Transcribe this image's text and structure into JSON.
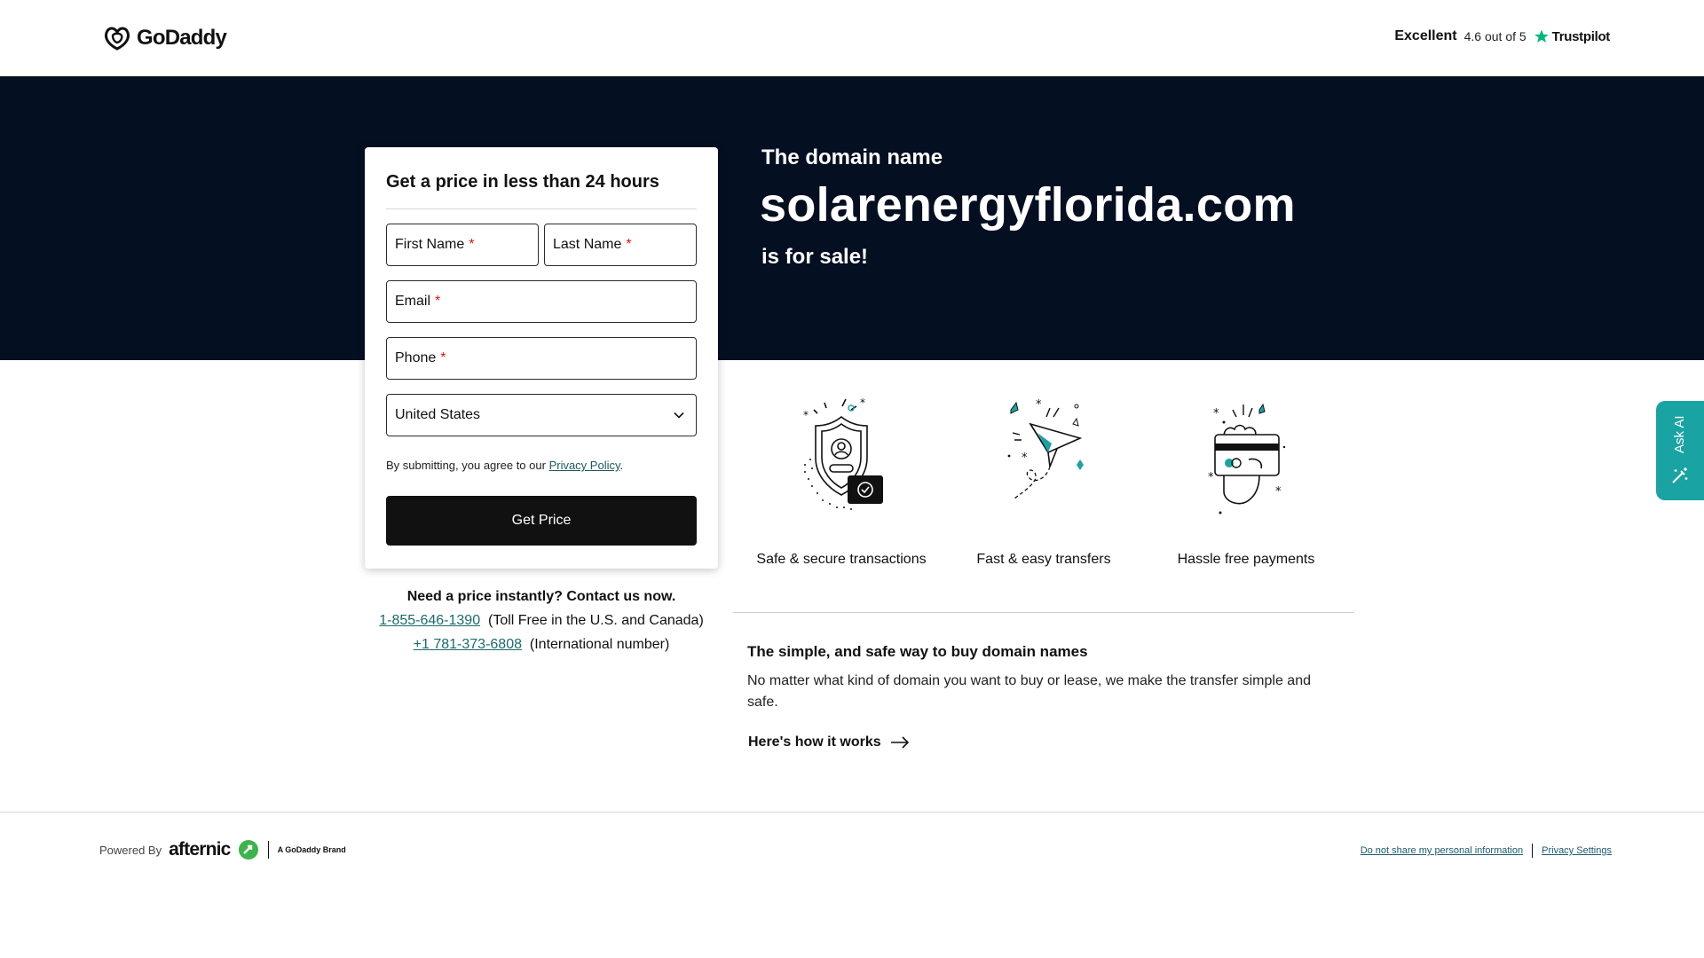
{
  "header": {
    "logo_text": "GoDaddy",
    "rating_label": "Excellent",
    "rating_score": "4.6 out of 5",
    "trustpilot_label": "Trustpilot"
  },
  "hero": {
    "kicker": "The domain name",
    "domain": "solarenergyflorida.com",
    "for_sale": "is for sale!"
  },
  "form": {
    "title": "Get a price in less than 24 hours",
    "first_name_label": "First Name",
    "last_name_label": "Last Name",
    "email_label": "Email",
    "phone_label": "Phone",
    "required_mark": "*",
    "country_value": "United States",
    "agree_text": "By submitting, you agree to our",
    "privacy_link": "Privacy Policy",
    "agree_end": ".",
    "submit_label": "Get Price"
  },
  "contact": {
    "heading": "Need a price instantly? Contact us now.",
    "toll_free_number": "1-855-646-1390",
    "toll_free_note": "(Toll Free in the U.S. and Canada)",
    "intl_number": "+1 781-373-6808",
    "intl_note": "(International number)"
  },
  "features": [
    {
      "label": "Safe & secure transactions",
      "icon": "shield-lock-icon"
    },
    {
      "label": "Fast & easy transfers",
      "icon": "paper-plane-icon"
    },
    {
      "label": "Hassle free payments",
      "icon": "credit-card-hand-icon"
    }
  ],
  "info": {
    "title": "The simple, and safe way to buy domain names",
    "body": "No matter what kind of domain you want to buy or lease, we make the transfer simple and safe.",
    "how_link": "Here's how it works"
  },
  "ask_ai": {
    "label": "Ask AI"
  },
  "footer": {
    "powered_by": "Powered By",
    "afternic": "afternic",
    "brand_note": "A GoDaddy Brand",
    "dnsmpi": "Do not share my personal information",
    "privacy_settings": "Privacy Settings"
  },
  "colors": {
    "hero_bg": "#040f22",
    "accent_teal": "#1aa3a3",
    "link_teal": "#1a6b6f",
    "button_bg": "#111111",
    "trustpilot_star": "#00b67a",
    "afternic_green": "#3cb44b"
  }
}
